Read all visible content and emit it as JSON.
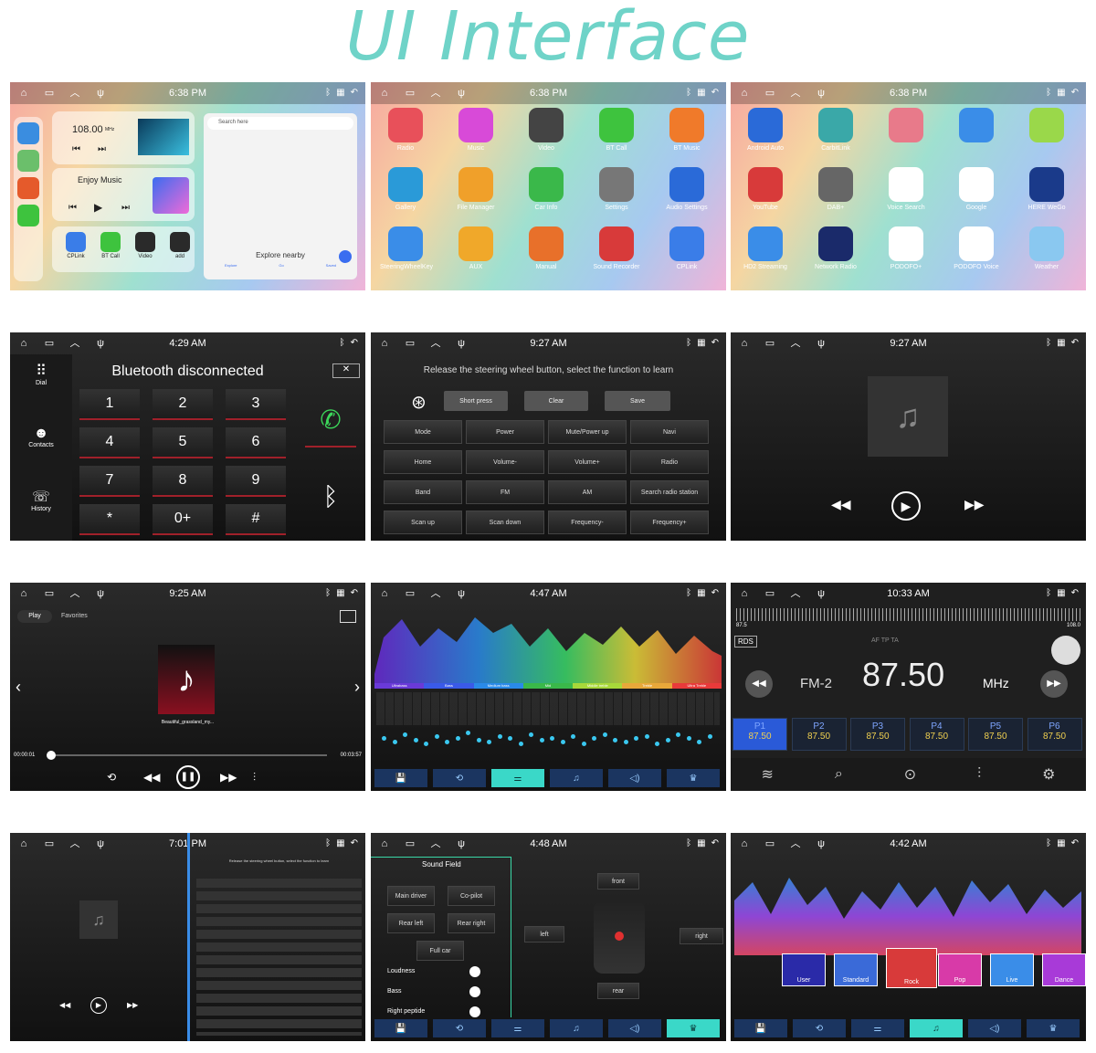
{
  "heading": "UI Interface",
  "s1": {
    "time": "6:38 PM",
    "freq": "108.00",
    "mhz": "MHz",
    "music": "Enjoy Music",
    "search": "Search here",
    "explore": "Explore nearby",
    "apps": [
      {
        "label": "CPLink",
        "icon": "cplink-icon"
      },
      {
        "label": "BT Call",
        "icon": "phone-icon"
      },
      {
        "label": "Video",
        "icon": "clapper-icon"
      },
      {
        "label": "add",
        "icon": "plus-icon"
      }
    ],
    "nav": [
      "Explore",
      "Go",
      "Saved"
    ]
  },
  "s2": {
    "time": "6:38 PM",
    "apps": [
      "Radio",
      "Music",
      "Video",
      "BT Call",
      "BT Music",
      "Gallery",
      "File Manager",
      "Car Info",
      "Settings",
      "Audio Settings",
      "SteeringWheelKey",
      "AUX",
      "Manual",
      "Sound Recorder",
      "CPLink"
    ]
  },
  "s3": {
    "time": "6:38 PM",
    "apps": [
      "Android Auto",
      "CarbitLink",
      "",
      "",
      "",
      "YouTube",
      "DAB+",
      "Voice Search",
      "Google",
      "HERE WeGo",
      "HD2 Streaming",
      "Network Radio",
      "PODOFO+",
      "PODOFO Voice",
      "Weather"
    ]
  },
  "s4": {
    "time": "4:29 AM",
    "status": "Bluetooth disconnected",
    "side": [
      "Dial",
      "Contacts",
      "History"
    ],
    "keys": [
      "1",
      "2",
      "3",
      "4",
      "5",
      "6",
      "7",
      "8",
      "9",
      "*",
      "0+",
      "#"
    ]
  },
  "s5": {
    "time": "9:27 AM",
    "instruction": "Release the steering wheel button, select the function to learn",
    "top": [
      "Short press",
      "Clear",
      "Save"
    ],
    "grid": [
      "Mode",
      "Power",
      "Mute/Power up",
      "Navi",
      "Home",
      "Volume-",
      "Volume+",
      "Radio",
      "Band",
      "FM",
      "AM",
      "Search radio station",
      "Scan up",
      "Scan down",
      "Frequency-",
      "Frequency+"
    ]
  },
  "s6": {
    "time": "9:27 AM"
  },
  "s7": {
    "time": "9:25 AM",
    "tabs": [
      "Play",
      "Favorites"
    ],
    "song": "Beautiful_grassland_my...",
    "elapsed": "00:00:01",
    "total": "00:03:57"
  },
  "s8": {
    "time": "4:47 AM",
    "bands": [
      "Ultrabass",
      "Bass",
      "Medium bass",
      "Mid",
      "Middle treble",
      "Treble",
      "Ultra Treble"
    ]
  },
  "s9": {
    "time": "10:33 AM",
    "low": "87.5",
    "high": "108.0",
    "rds": "RDS",
    "band": "FM-2",
    "freq": "87.50",
    "unit": "MHz",
    "flags": "AF TP TA",
    "presets": [
      {
        "n": "P1",
        "f": "87.50"
      },
      {
        "n": "P2",
        "f": "87.50"
      },
      {
        "n": "P3",
        "f": "87.50"
      },
      {
        "n": "P4",
        "f": "87.50"
      },
      {
        "n": "P5",
        "f": "87.50"
      },
      {
        "n": "P6",
        "f": "87.50"
      }
    ]
  },
  "s10": {
    "time": "7:01 PM",
    "instruction": "Release the steering wheel button, select the function to learn"
  },
  "s11": {
    "time": "4:48 AM",
    "title": "Sound Field",
    "seats": [
      "Main driver",
      "Co-pilot",
      "Rear left",
      "Rear right",
      "Full car"
    ],
    "toggles": [
      "Loudness",
      "Bass",
      "Right peptide"
    ],
    "pos": [
      "front",
      "left",
      "right",
      "rear"
    ]
  },
  "s12": {
    "time": "4:42 AM",
    "presets": [
      "User",
      "Standard",
      "Rock",
      "Pop",
      "Live",
      "Dance"
    ]
  }
}
